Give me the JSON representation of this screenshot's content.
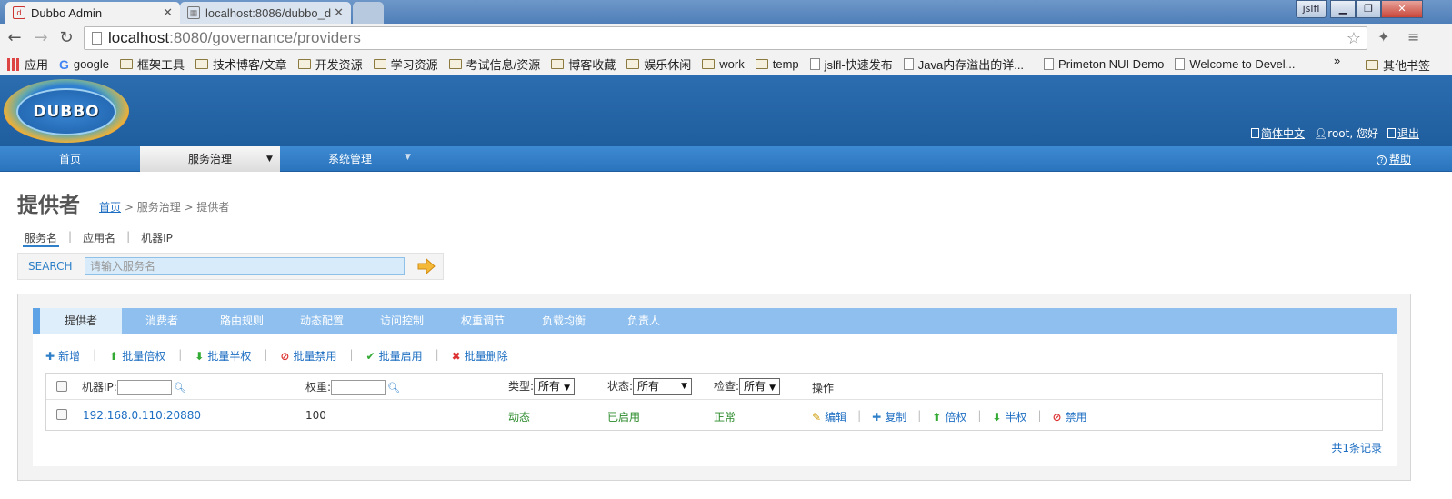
{
  "browser": {
    "tabs": [
      {
        "title": "Dubbo Admin"
      },
      {
        "title": "localhost:8086/dubbo_d"
      }
    ],
    "window_user": "jslfl",
    "url_host": "localhost",
    "url_path": ":8080/governance/providers",
    "bookmarks": [
      {
        "label": "应用",
        "icon": "apps-icon"
      },
      {
        "label": "google",
        "icon": "google-icon"
      },
      {
        "label": "框架工具",
        "icon": "folder-icon"
      },
      {
        "label": "技术博客/文章",
        "icon": "folder-icon"
      },
      {
        "label": "开发资源",
        "icon": "folder-icon"
      },
      {
        "label": "学习资源",
        "icon": "folder-icon"
      },
      {
        "label": "考试信息/资源",
        "icon": "folder-icon"
      },
      {
        "label": "博客收藏",
        "icon": "folder-icon"
      },
      {
        "label": "娱乐休闲",
        "icon": "folder-icon"
      },
      {
        "label": "work",
        "icon": "folder-icon"
      },
      {
        "label": "temp",
        "icon": "folder-icon"
      },
      {
        "label": "jslfl-快速发布",
        "icon": "page-icon"
      },
      {
        "label": "Java内存溢出的详...",
        "icon": "page-icon"
      },
      {
        "label": "Primeton NUI Demo",
        "icon": "page-icon"
      },
      {
        "label": "Welcome to Devel...",
        "icon": "page-icon"
      }
    ],
    "bookmarks_more": "»",
    "bookmarks_other": "其他书签"
  },
  "header": {
    "logo_text": "DUBBO",
    "lang_link": "简体中文",
    "user_greeting": "root, 您好",
    "logout": "退出"
  },
  "nav": {
    "items": [
      {
        "label": "首页"
      },
      {
        "label": "服务治理"
      },
      {
        "label": "系统管理"
      }
    ],
    "help": "帮助"
  },
  "page": {
    "title": "提供者",
    "breadcrumb_home": "首页",
    "breadcrumb_rest": " > 服务治理 > 提供者"
  },
  "search": {
    "tabs": [
      "服务名",
      "应用名",
      "机器IP"
    ],
    "label": "SEARCH",
    "placeholder": "请输入服务名"
  },
  "subtabs": [
    "提供者",
    "消费者",
    "路由规则",
    "动态配置",
    "访问控制",
    "权重调节",
    "负载均衡",
    "负责人"
  ],
  "actions": [
    "新增",
    "批量倍权",
    "批量半权",
    "批量禁用",
    "批量启用",
    "批量删除"
  ],
  "table": {
    "headers": {
      "ip": "机器IP:",
      "weight": "权重:",
      "type": "类型:",
      "type_value": "所有",
      "status": "状态:",
      "status_value": "所有",
      "check": "检查:",
      "check_value": "所有",
      "ops": "操作"
    },
    "rows": [
      {
        "address": "192.168.0.110:20880",
        "weight": "100",
        "type": "动态",
        "status": "已启用",
        "check": "正常",
        "ops": [
          "编辑",
          "复制",
          "倍权",
          "半权",
          "禁用"
        ]
      }
    ],
    "total": "共1条记录"
  }
}
